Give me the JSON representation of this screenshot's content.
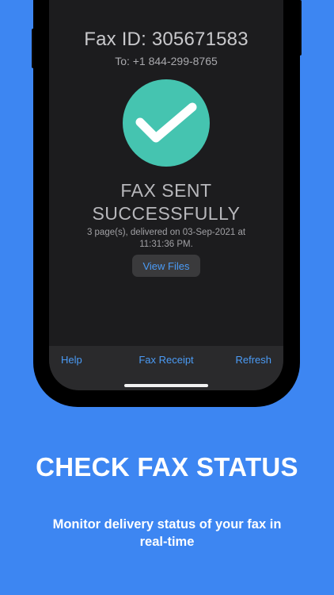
{
  "fax": {
    "id_text": "Fax ID: 305671583",
    "to_text": "To: +1 844-299-8765",
    "status_line1": "FAX SENT",
    "status_line2": "SUCCESSFULLY",
    "detail": "3 page(s), delivered on 03-Sep-2021 at 11:31:36 PM.",
    "view_files_label": "View Files",
    "status_icon": "checkmark-icon"
  },
  "toolbar": {
    "help_label": "Help",
    "receipt_label": "Fax Receipt",
    "refresh_label": "Refresh"
  },
  "promo": {
    "headline": "CHECK FAX STATUS",
    "subline": "Monitor delivery status of your fax in real-time"
  },
  "colors": {
    "background": "#3d86f2",
    "screen": "#1c1c1e",
    "success": "#45c4b0",
    "link": "#4b9bf5"
  }
}
